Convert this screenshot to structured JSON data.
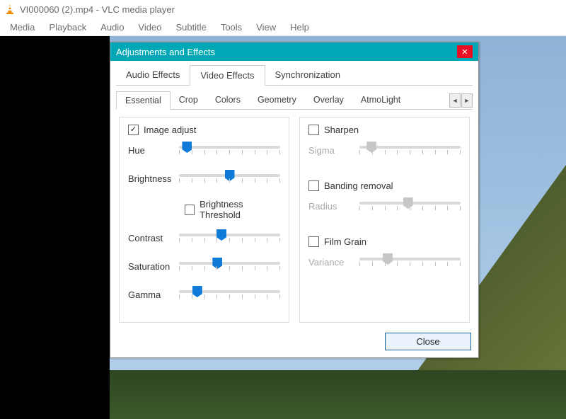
{
  "window": {
    "title": "VI000060 (2).mp4 - VLC media player"
  },
  "menu": {
    "items": [
      "Media",
      "Playback",
      "Audio",
      "Video",
      "Subtitle",
      "Tools",
      "View",
      "Help"
    ]
  },
  "dialog": {
    "title": "Adjustments and Effects",
    "close_glyph": "✕",
    "tabs_main": {
      "audio": "Audio Effects",
      "video": "Video Effects",
      "sync": "Synchronization"
    },
    "tabs_sub": {
      "essential": "Essential",
      "crop": "Crop",
      "colors": "Colors",
      "geometry": "Geometry",
      "overlay": "Overlay",
      "atmolight": "AtmoLight"
    },
    "scroll_left": "◄",
    "scroll_right": "►",
    "left": {
      "image_adjust": "Image adjust",
      "hue": "Hue",
      "brightness": "Brightness",
      "brightness_threshold": "Brightness Threshold",
      "contrast": "Contrast",
      "saturation": "Saturation",
      "gamma": "Gamma"
    },
    "right": {
      "sharpen": "Sharpen",
      "sigma": "Sigma",
      "banding": "Banding removal",
      "radius": "Radius",
      "filmgrain": "Film Grain",
      "variance": "Variance"
    },
    "close_btn": "Close"
  },
  "sliders": {
    "hue": 8,
    "brightness": 50,
    "contrast": 42,
    "saturation": 38,
    "gamma": 18,
    "sigma": 12,
    "radius": 48,
    "variance": 28
  },
  "colors": {
    "accent": "#0f7ad8",
    "titlebar": "#00a8b5",
    "close": "#e81123"
  }
}
